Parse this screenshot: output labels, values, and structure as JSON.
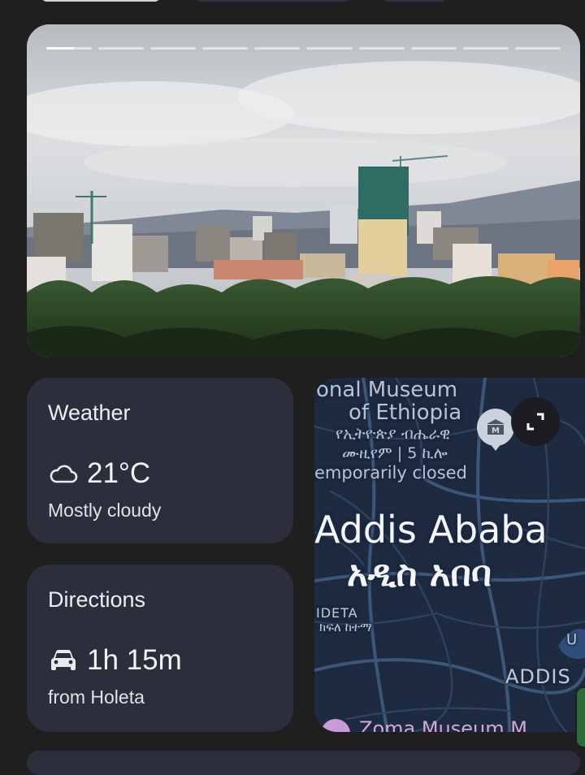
{
  "hero": {
    "image_alt": "Addis Ababa skyline",
    "story_segments": 10,
    "active_segment": 1,
    "active_segment_progress": 0.6
  },
  "weather": {
    "title": "Weather",
    "temperature": "21°C",
    "condition": "Mostly cloudy",
    "icon": "cloud-icon"
  },
  "directions": {
    "title": "Directions",
    "duration": "1h 15m",
    "origin": "from Holeta",
    "icon": "car-icon"
  },
  "map": {
    "poi_line1": "onal Museum",
    "poi_line2": "of Ethiopia",
    "poi_am_line1": "የኢትዮጵያ ብሔራዊ",
    "poi_am_line2": "ሙዚየም | 5 ኪሎ",
    "poi_status": "emporarily closed",
    "city_name": "Addis Ababa",
    "city_name_am": "አዲስ አበባ",
    "district": "IDETA",
    "district_am": "ክፍለ ከተማ",
    "area_u": "U",
    "area_addis": "ADDIS",
    "bottom_poi": "Zoma Museum M",
    "museum_icon": "museum-icon",
    "expand_icon": "expand-icon"
  },
  "colors": {
    "background": "#1f1f1f",
    "card": "#2c2f3b",
    "map_bg": "#1d2a40"
  }
}
